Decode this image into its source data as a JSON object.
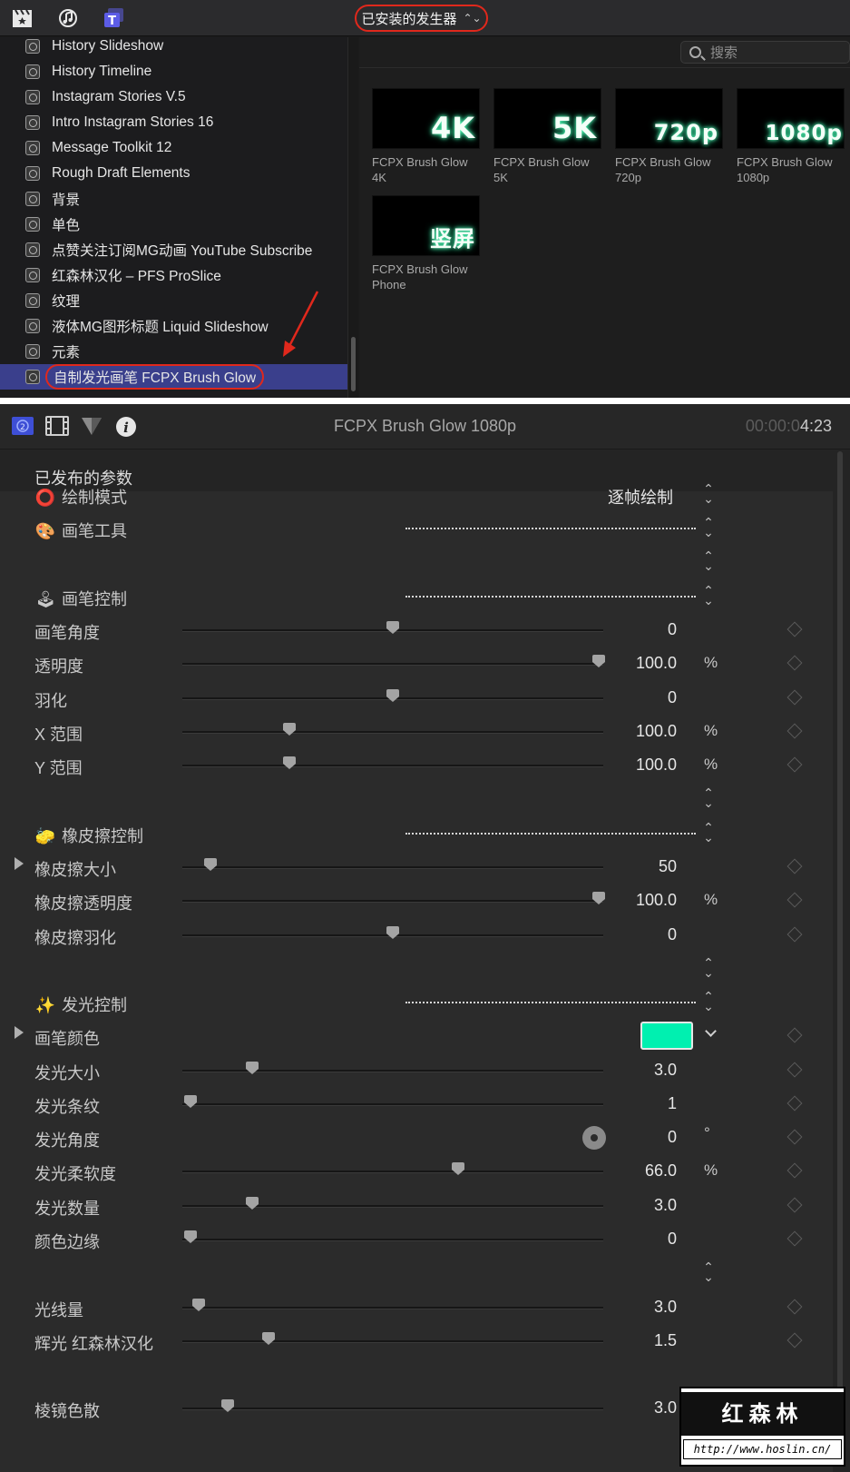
{
  "browser": {
    "category_popup": "已安装的发生器",
    "search_placeholder": "搜索",
    "sidebar_items": [
      "History Slideshow",
      "History Timeline",
      "Instagram Stories V.5",
      "Intro Instagram Stories 16",
      "Message Toolkit 12",
      "Rough Draft Elements",
      "背景",
      "单色",
      "点赞关注订阅MG动画 YouTube Subscribe",
      "红森林汉化 – PFS ProSlice",
      "纹理",
      "液体MG图形标题 Liquid Slideshow",
      "元素",
      "自制发光画笔 FCPX Brush Glow"
    ],
    "selected_item_index": 13,
    "thumbnails": [
      {
        "overlay": "4K",
        "caption1": "FCPX Brush Glow",
        "caption2": "4K"
      },
      {
        "overlay": "5K",
        "caption1": "FCPX Brush Glow",
        "caption2": "5K"
      },
      {
        "overlay": "720p",
        "caption1": "FCPX Brush Glow",
        "caption2": "720p"
      },
      {
        "overlay": "1080p",
        "caption1": "FCPX Brush Glow",
        "caption2": "1080p"
      },
      {
        "overlay": "竖屏",
        "caption1": "FCPX Brush Glow",
        "caption2": "Phone"
      }
    ]
  },
  "inspector": {
    "title": "FCPX Brush Glow 1080p",
    "timecode_dim": "00:00:0",
    "timecode_bright": "4:23",
    "section_title": "已发布的参数",
    "rows": {
      "draw_mode": {
        "label": "绘制模式",
        "value": "逐帧绘制"
      },
      "brush_tool": {
        "label": "画笔工具"
      },
      "brush_control": {
        "label": "画笔控制"
      },
      "brush_angle": {
        "label": "画笔角度",
        "value": "0",
        "level": 0.5
      },
      "opacity": {
        "label": "透明度",
        "value": "100.0",
        "unit": "%",
        "level": 1.0
      },
      "feather": {
        "label": "羽化",
        "value": "0",
        "level": 0.5
      },
      "x_range": {
        "label": "X 范围",
        "value": "100.0",
        "unit": "%",
        "level": 0.25
      },
      "y_range": {
        "label": "Y 范围",
        "value": "100.0",
        "unit": "%",
        "level": 0.25
      },
      "eraser_control": {
        "label": "橡皮擦控制"
      },
      "eraser_size": {
        "label": "橡皮擦大小",
        "value": "50",
        "level": 0.06
      },
      "eraser_opacity": {
        "label": "橡皮擦透明度",
        "value": "100.0",
        "unit": "%",
        "level": 1.0
      },
      "eraser_feather": {
        "label": "橡皮擦羽化",
        "value": "0",
        "level": 0.5
      },
      "glow_control": {
        "label": "发光控制"
      },
      "brush_color": {
        "label": "画笔颜色",
        "color": "#00f0b0"
      },
      "glow_size": {
        "label": "发光大小",
        "value": "3.0",
        "level": 0.16
      },
      "glow_stripes": {
        "label": "发光条纹",
        "value": "1",
        "level": 0.01
      },
      "glow_angle": {
        "label": "发光角度",
        "value": "0",
        "unit": "°"
      },
      "glow_softness": {
        "label": "发光柔软度",
        "value": "66.0",
        "unit": "%",
        "level": 0.66
      },
      "glow_count": {
        "label": "发光数量",
        "value": "3.0",
        "level": 0.16
      },
      "color_edge": {
        "label": "颜色边缘",
        "value": "0",
        "level": 0.01
      },
      "light_amount": {
        "label": "光线量",
        "value": "3.0",
        "level": 0.03
      },
      "glare": {
        "label": "辉光 红森林汉化",
        "value": "1.5",
        "level": 0.2
      },
      "prism": {
        "label": "棱镜色散",
        "value": "3.0",
        "level": 0.1
      }
    }
  },
  "watermark": {
    "title": "红森林",
    "url": "http://www.hoslin.cn/"
  },
  "colors": {
    "accent_red": "#e0281c",
    "selection_blue": "#3a3f8c",
    "brush_color": "#00f0b0"
  }
}
